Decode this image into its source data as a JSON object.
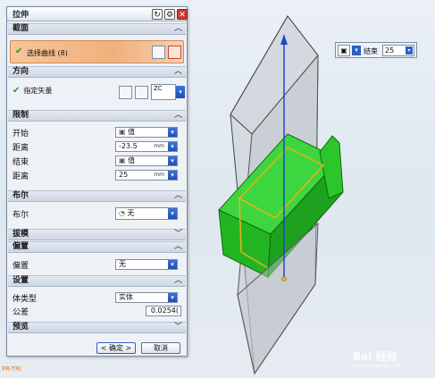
{
  "dialog": {
    "title": "拉伸",
    "sections": {
      "section": {
        "title": "截面",
        "select_curve_label": "选择曲线 (8)"
      },
      "direction": {
        "title": "方向",
        "vector_label": "指定矢量",
        "vector_value": "ZC"
      },
      "limits": {
        "title": "限制",
        "start_label": "开始",
        "start_value": "值",
        "start_distance_label": "距离",
        "start_distance_value": "-23.5",
        "start_distance_unit": "mm",
        "end_label": "结束",
        "end_value": "值",
        "end_distance_label": "距离",
        "end_distance_value": "25",
        "end_distance_unit": "mm"
      },
      "boolean": {
        "title": "布尔",
        "boolean_label": "布尔",
        "boolean_value": "无"
      },
      "draft": {
        "title": "拔模"
      },
      "offset": {
        "title": "偏置",
        "offset_label": "偏置",
        "offset_value": "无"
      },
      "settings": {
        "title": "设置",
        "body_type_label": "体类型",
        "body_type_value": "实体",
        "tolerance_label": "公差",
        "tolerance_value": "0.0254("
      },
      "preview": {
        "title": "预览"
      }
    },
    "buttons": {
      "ok": "< 确定 >",
      "cancel": "取消"
    }
  },
  "floating_input": {
    "label": "结束",
    "value": "25"
  },
  "viewport": {
    "label": "PR-TRI"
  },
  "watermark": {
    "text": "Bai 经验",
    "domain": "jingyan.baidu.com"
  },
  "colors": {
    "extrude_green": "#2bd12b",
    "accent_orange": "#f0b07c",
    "axis_blue": "#1c49c9"
  }
}
